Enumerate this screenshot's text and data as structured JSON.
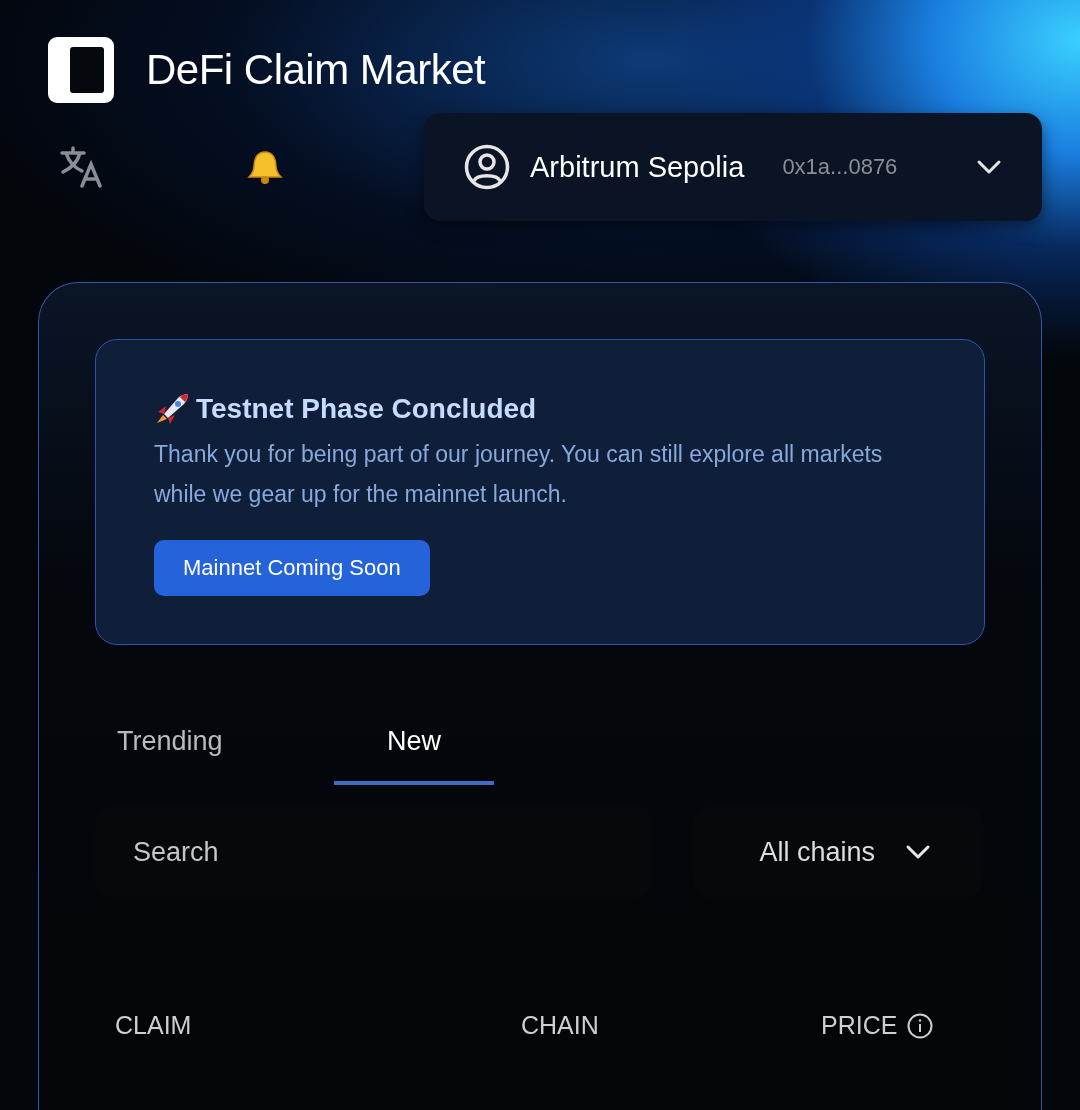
{
  "app": {
    "title": "DeFi Claim Market"
  },
  "account": {
    "network": "Arbitrum Sepolia",
    "address": "0x1a...0876"
  },
  "notice": {
    "title": "Testnet Phase Concluded",
    "text": "Thank you for being part of our journey. You can still explore all markets while we gear up for the mainnet launch.",
    "button": "Mainnet Coming Soon"
  },
  "tabs": [
    {
      "label": "Trending",
      "selected": false
    },
    {
      "label": "New",
      "selected": true
    }
  ],
  "search": {
    "placeholder": "Search"
  },
  "chain_filter": {
    "value": "All chains"
  },
  "table": {
    "columns": [
      {
        "label": "CLAIM",
        "info": false
      },
      {
        "label": "CHAIN",
        "info": false
      },
      {
        "label": "PRICE",
        "info": true
      }
    ]
  }
}
